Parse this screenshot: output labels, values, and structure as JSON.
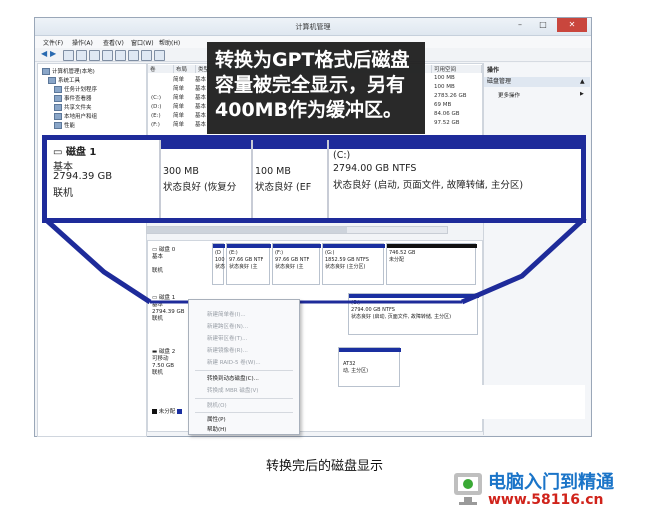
{
  "window": {
    "title": "计算机管理",
    "menu": [
      "文件(F)",
      "操作(A)",
      "查看(V)",
      "窗口(W)",
      "帮助(H)"
    ]
  },
  "tree": {
    "items": [
      "计算机管理(本地)",
      "系统工具",
      "任务计划程序",
      "事件查看器",
      "共享文件夹",
      "本地用户和组",
      "性能"
    ]
  },
  "volume_list": {
    "headers": [
      "卷",
      "布局",
      "类型",
      "可用空间"
    ],
    "rows": [
      {
        "vol": "",
        "layout": "简单",
        "type": "基本",
        "free": "100 MB"
      },
      {
        "vol": "",
        "layout": "简单",
        "type": "基本",
        "free": "100 MB"
      },
      {
        "vol": "(C:)",
        "layout": "简单",
        "type": "基本",
        "free": "2783.26 GB"
      },
      {
        "vol": "(D:)",
        "layout": "简单",
        "type": "基本",
        "free": "69 MB"
      },
      {
        "vol": "(E:)",
        "layout": "简单",
        "type": "基本",
        "free": "84.06 GB"
      },
      {
        "vol": "(F:)",
        "layout": "简单",
        "type": "基本",
        "free": "97.52 GB"
      }
    ]
  },
  "actions": {
    "header": "操作",
    "section": "磁盘管理",
    "more": "更多操作"
  },
  "annotation": {
    "line1": "转换为GPT格式后磁盘",
    "line2": "容量被完全显示，另有",
    "line3": "400MB作为缓冲区。"
  },
  "zoom": {
    "disk_title": "磁盘 1",
    "disk_type": "基本",
    "disk_size": "2794.39 GB",
    "disk_status": "联机",
    "partitions": [
      {
        "name": "",
        "size": "300 MB",
        "status": "状态良好 (恢复分"
      },
      {
        "name": "",
        "size": "100 MB",
        "status": "状态良好 (EF"
      },
      {
        "name": "(C:)",
        "size": "2794.00 GB NTFS",
        "status": "状态良好 (启动, 页面文件, 故障转储, 主分区)"
      }
    ]
  },
  "diskmap": {
    "disk0": {
      "title": "磁盘 0",
      "type": "基本",
      "status": "联机",
      "parts": [
        {
          "name": "(D",
          "l1": "100",
          "l2": "状态"
        },
        {
          "name": "(E:)",
          "l1": "97.66 GB NTF",
          "l2": "状态良好 (主"
        },
        {
          "name": "(F:)",
          "l1": "97.66 GB NTF",
          "l2": "状态良好 (主"
        },
        {
          "name": "(G:)",
          "l1": "1852.59 GB NTFS",
          "l2": "状态良好 (主分区)"
        },
        {
          "name": "",
          "l1": "746.52 GB",
          "l2": "未分配"
        }
      ]
    },
    "disk1": {
      "title": "磁盘 1",
      "type": "基本",
      "size": "2794.39 GB",
      "status": "联机",
      "part_c": {
        "name": "(C:)",
        "l1": "2794.00 GB NTFS",
        "l2": "状态良好 (启动, 页面文件, 故障转储, 主分区)"
      }
    },
    "disk2": {
      "title": "磁盘 2",
      "type": "可移动",
      "size": "7.50 GB",
      "status": "联机",
      "part": {
        "l1": "AT32",
        "l2": "动, 主分区)"
      }
    },
    "legend": "未分配"
  },
  "context_menu": {
    "items": [
      {
        "label": "新建简单卷(I)...",
        "enabled": false
      },
      {
        "label": "新建跨区卷(N)...",
        "enabled": false
      },
      {
        "label": "新建带区卷(T)...",
        "enabled": false
      },
      {
        "label": "新建镜像卷(R)...",
        "enabled": false
      },
      {
        "label": "新建 RAID-5 卷(W)...",
        "enabled": false
      },
      {
        "label": "转换到动态磁盘(C)...",
        "enabled": true
      },
      {
        "label": "转换成 MBR 磁盘(V)",
        "enabled": false
      },
      {
        "label": "脱机(O)",
        "enabled": false
      },
      {
        "label": "属性(P)",
        "enabled": true
      },
      {
        "label": "帮助(H)",
        "enabled": true
      }
    ]
  },
  "caption": "转换完后的磁盘显示",
  "logo": {
    "name": "电脑入门到精通",
    "url": "www.58116.cn"
  },
  "colors": {
    "accent_blue": "#1e2b9a",
    "annot_bg": "#1c1c1c",
    "logo_blue": "#1a74c8",
    "logo_red": "#d0231b"
  }
}
